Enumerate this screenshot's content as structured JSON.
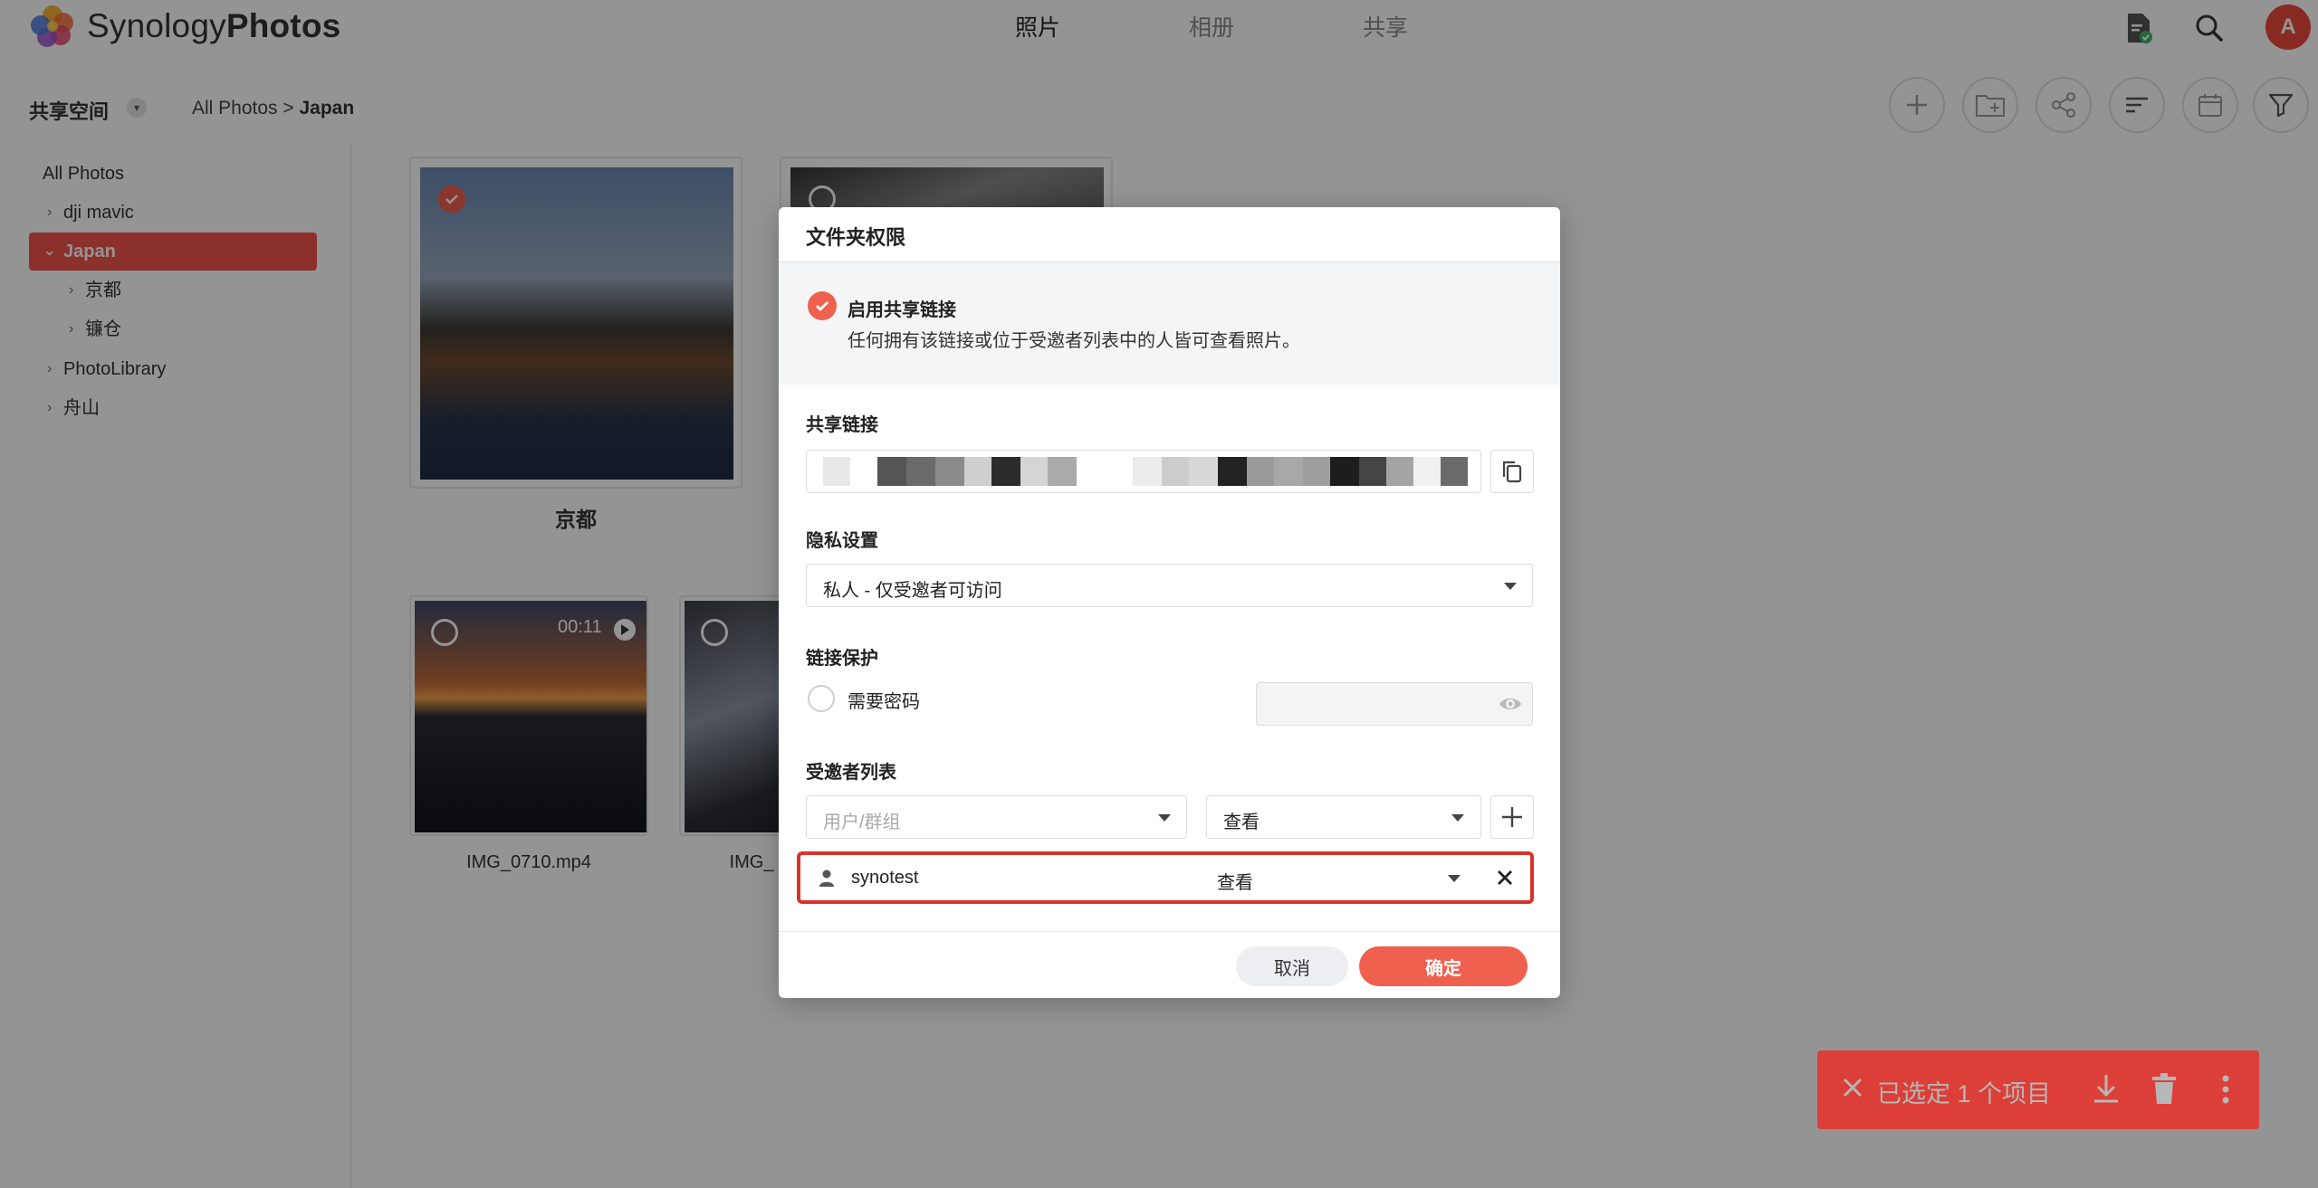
{
  "app": {
    "name_regular": "Synology",
    "name_bold": "Photos",
    "avatar_letter": "A"
  },
  "main_tabs": [
    {
      "label": "照片",
      "active": true
    },
    {
      "label": "相册",
      "active": false
    },
    {
      "label": "共享",
      "active": false
    }
  ],
  "toolbar": {
    "space_title": "共享空间",
    "breadcrumb_root": "All Photos",
    "breadcrumb_sep": " > ",
    "breadcrumb_current": "Japan"
  },
  "sidebar": {
    "items": [
      {
        "label": "All Photos"
      },
      {
        "label": "dji mavic"
      },
      {
        "label": "Japan",
        "active": true
      },
      {
        "label": "京都"
      },
      {
        "label": "镰仓"
      },
      {
        "label": "PhotoLibrary"
      },
      {
        "label": "舟山"
      }
    ]
  },
  "content": {
    "folder_caption": "京都",
    "video_duration": "00:11",
    "video_caption": "IMG_0710.mp4",
    "partial_caption": "IMG_"
  },
  "dialog": {
    "title": "文件夹权限",
    "enable_label": "启用共享链接",
    "enable_desc": "任何拥有该链接或位于受邀者列表中的人皆可查看照片。",
    "share_link_label": "共享链接",
    "privacy_label": "隐私设置",
    "privacy_value": "私人 - 仅受邀者可访问",
    "protection_label": "链接保护",
    "password_label": "需要密码",
    "invitees_label": "受邀者列表",
    "user_group_placeholder": "用户/群组",
    "permission_value": "查看",
    "invitee_name": "synotest",
    "invitee_permission": "查看",
    "cancel_label": "取消",
    "ok_label": "确定"
  },
  "selection_bar": {
    "text": "已选定 1 个项目"
  },
  "colors": {
    "accent": "#f0604f",
    "highlight": "#d9322a",
    "selection_bar": "#dc3f37"
  }
}
